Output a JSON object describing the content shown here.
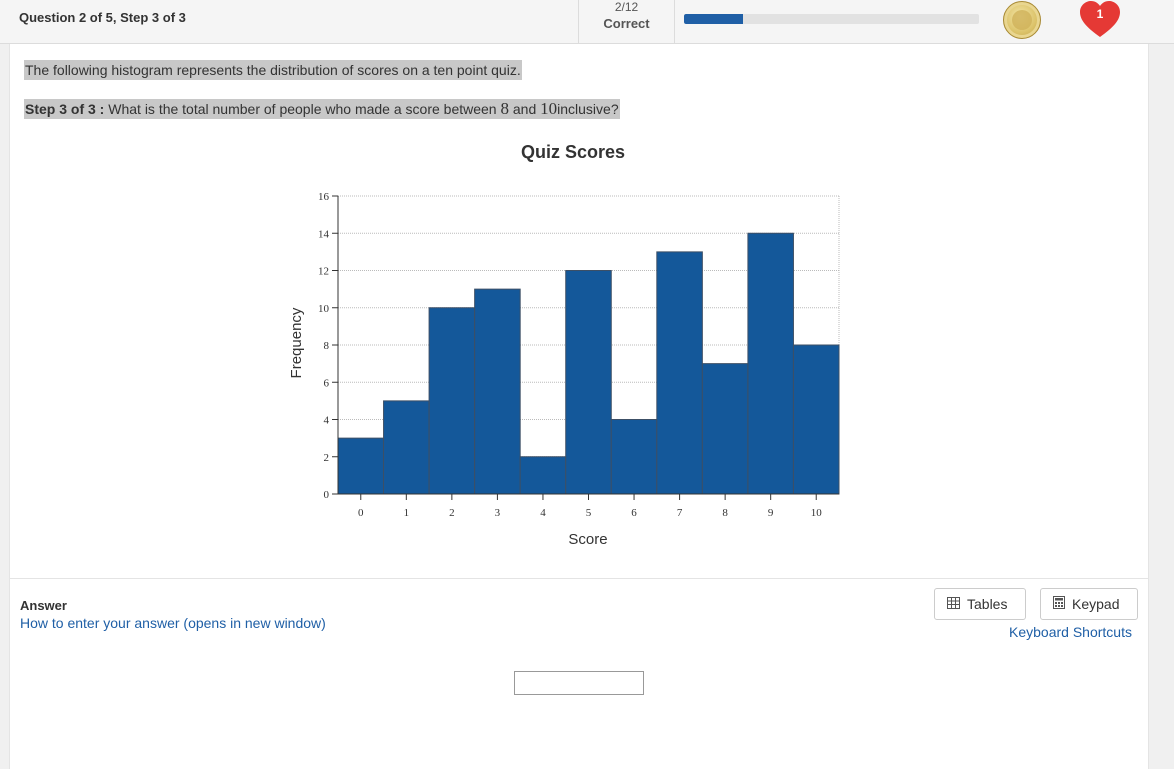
{
  "header": {
    "question_label": "Question 2 of 5, Step 3 of 3",
    "score_fraction": "2/12",
    "score_status": "Correct",
    "progress_fraction": 0.2,
    "progress_color": "#1f5fa6",
    "coin_icon": "coin-icon",
    "heart_icon": "heart-icon",
    "hearts_count": "1"
  },
  "question": {
    "intro": "The following histogram represents the distribution of scores on a ten point quiz.",
    "step_label": "Step 3 of 3 :",
    "prompt_before": "What is the total number of people who made a score between",
    "value_low": "8",
    "prompt_mid": "and",
    "value_high": "10",
    "prompt_after": "inclusive?"
  },
  "chart_data": {
    "type": "bar",
    "title": "Quiz Scores",
    "xlabel": "Score",
    "ylabel": "Frequency",
    "categories": [
      "0",
      "1",
      "2",
      "3",
      "4",
      "5",
      "6",
      "7",
      "8",
      "9",
      "10"
    ],
    "values": [
      3,
      5,
      10,
      11,
      2,
      12,
      4,
      13,
      7,
      14,
      8
    ],
    "ylim": [
      0,
      16
    ],
    "yticks": [
      "0",
      "2",
      "4",
      "6",
      "8",
      "10",
      "12",
      "14",
      "16"
    ],
    "grid": true,
    "bar_color": "#14589a"
  },
  "answer": {
    "label": "Answer",
    "help_link": "How to enter your answer (opens in new window)",
    "tables_label": "Tables",
    "keypad_label": "Keypad",
    "keyboard_shortcuts": "Keyboard Shortcuts",
    "input_value": ""
  }
}
